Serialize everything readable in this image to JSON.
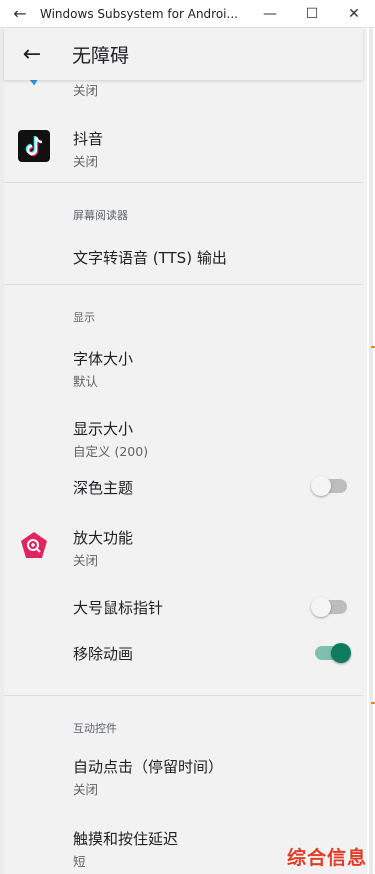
{
  "window": {
    "back_glyph": "←",
    "title": "Windows Subsystem for Androi...",
    "minimize": "—",
    "maximize": "☐",
    "close": "✕"
  },
  "app_bar": {
    "back_glyph": "←",
    "title": "无障碍"
  },
  "items": {
    "partial_app_subtitle": "关闭",
    "douyin": {
      "title": "抖音",
      "subtitle": "关闭"
    },
    "section_reader": "屏幕阅读器",
    "tts": {
      "title": "文字转语音 (TTS) 输出"
    },
    "section_display": "显示",
    "font_size": {
      "title": "字体大小",
      "subtitle": "默认"
    },
    "display_size": {
      "title": "显示大小",
      "subtitle": "自定义 (200)"
    },
    "dark_theme": {
      "title": "深色主题",
      "toggle": "off"
    },
    "magnification": {
      "title": "放大功能",
      "subtitle": "关闭"
    },
    "large_pointer": {
      "title": "大号鼠标指针",
      "toggle": "off"
    },
    "remove_animations": {
      "title": "移除动画",
      "toggle": "on"
    },
    "section_interaction": "互动控件",
    "autoclick": {
      "title": "自动点击（停留时间）",
      "subtitle": "关闭"
    },
    "touch_hold": {
      "title": "触摸和按住延迟",
      "subtitle": "短"
    }
  },
  "watermark": "综合信息",
  "colors": {
    "accent": "#0f7b61",
    "magnify_icon": "#e0245e",
    "watermark": "#e23b24"
  }
}
